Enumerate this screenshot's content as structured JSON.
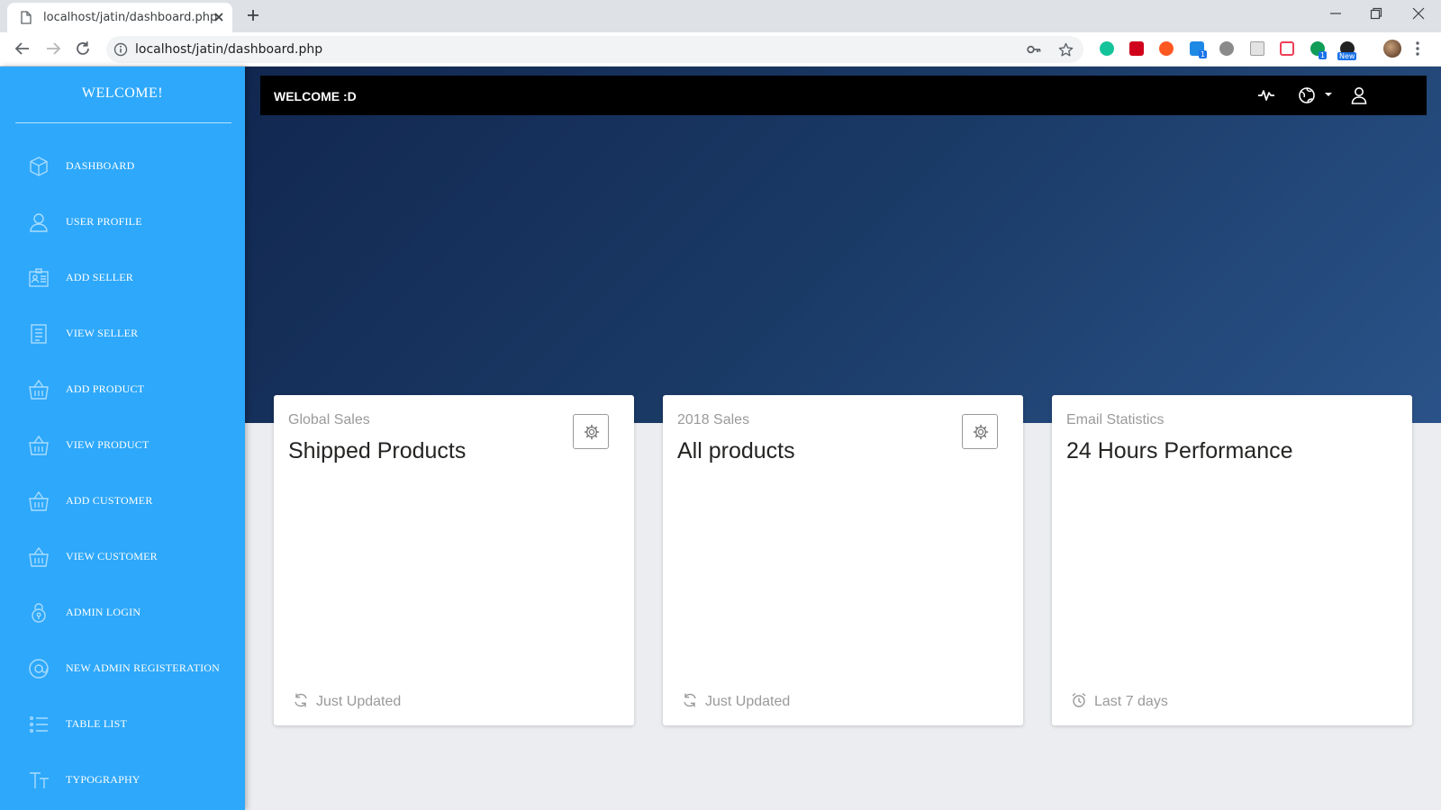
{
  "browser": {
    "tab_title": "localhost/jatin/dashboard.php",
    "url": "localhost/jatin/dashboard.php",
    "extensions": [
      {
        "name": "grammarly-icon",
        "color": "#15c39a"
      },
      {
        "name": "video-ext-icon",
        "color": "#d0021b"
      },
      {
        "name": "loop-ext-icon",
        "color": "#ff5722"
      },
      {
        "name": "skype-ext-icon",
        "color": "#1e88e5",
        "badge": "1"
      },
      {
        "name": "circle-ext-icon",
        "color": "#8a8a8a"
      },
      {
        "name": "doc-ext-icon",
        "color": "#9e9e9e"
      },
      {
        "name": "pocket-ext-icon",
        "color": "#ef3f56"
      },
      {
        "name": "chat-ext-icon",
        "color": "#0f9d58",
        "badge": "1"
      },
      {
        "name": "dark-ext-icon",
        "color": "#222222",
        "badge": "New"
      }
    ]
  },
  "sidebar": {
    "brand": "WELCOME!",
    "items": [
      {
        "label": "DASHBOARD",
        "icon": "box-icon"
      },
      {
        "label": "USER PROFILE",
        "icon": "user-icon"
      },
      {
        "label": "ADD SELLER",
        "icon": "id-card-icon"
      },
      {
        "label": "VIEW SELLER",
        "icon": "list-doc-icon"
      },
      {
        "label": "ADD PRODUCT",
        "icon": "basket-icon"
      },
      {
        "label": "VIEW PRODUCT",
        "icon": "basket-icon"
      },
      {
        "label": "ADD CUSTOMER",
        "icon": "basket-icon"
      },
      {
        "label": "VIEW CUSTOMER",
        "icon": "basket-icon"
      },
      {
        "label": "ADMIN LOGIN",
        "icon": "lock-icon"
      },
      {
        "label": "NEW ADMIN REGISTERATION",
        "icon": "at-icon"
      },
      {
        "label": "TABLE LIST",
        "icon": "bullet-list-icon"
      },
      {
        "label": "TYPOGRAPHY",
        "icon": "text-icon"
      }
    ]
  },
  "topnav": {
    "title": "WELCOME :D"
  },
  "cards": [
    {
      "category": "Global Sales",
      "title": "Shipped Products",
      "footer": "Just Updated",
      "footer_icon": "refresh-icon",
      "has_gear": true
    },
    {
      "category": "2018 Sales",
      "title": "All products",
      "footer": "Just Updated",
      "footer_icon": "refresh-icon",
      "has_gear": true
    },
    {
      "category": "Email Statistics",
      "title": "24 Hours Performance",
      "footer": "Last 7 days",
      "footer_icon": "alarm-clock-icon",
      "has_gear": false
    }
  ],
  "colors": {
    "sidebar": "#2ea8fb",
    "topnav": "#000000",
    "hero_start": "#112750",
    "hero_end": "#2a5389",
    "page_bg": "#ebedf0"
  }
}
